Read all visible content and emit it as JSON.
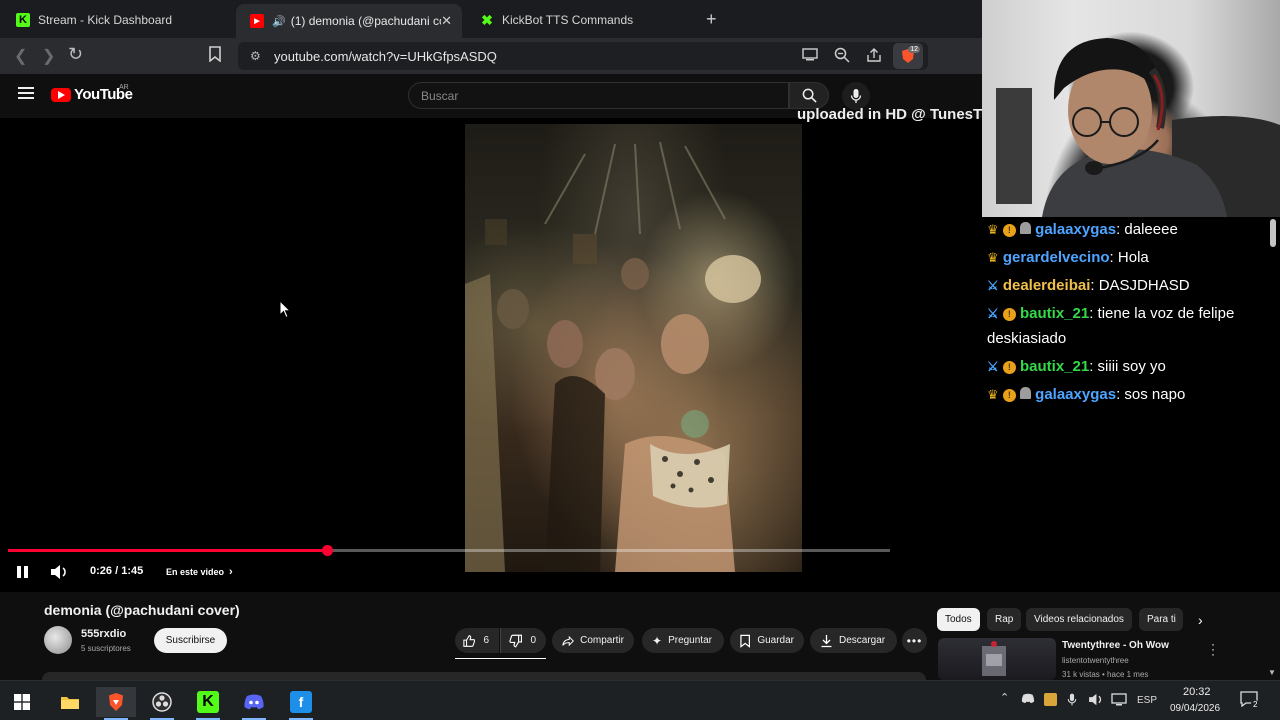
{
  "browser": {
    "tabs": [
      {
        "title": "Stream - Kick Dashboard",
        "icon": "kick-icon"
      },
      {
        "title": "(1) demonia (@pachudani cov",
        "icon": "youtube-icon",
        "active": true,
        "audio": true
      },
      {
        "title": "KickBot TTS Commands",
        "icon": "kickbot-icon"
      }
    ],
    "url": "youtube.com/watch?v=UHkGfpsASDQ",
    "brave_badge": "12"
  },
  "youtube": {
    "logo_text": "YouTube",
    "country_code": "AR",
    "search_placeholder": "Buscar"
  },
  "player": {
    "overlay_text": "uploaded in HD @ TunesT",
    "current_time": "0:26",
    "duration": "1:45",
    "time_separator": " / ",
    "chapter_label": "En este video",
    "progress_fraction": 0.3619,
    "hd_badge": "HD"
  },
  "chat": {
    "messages": [
      {
        "badges": [
          "crown",
          "coin",
          "ghost"
        ],
        "user": "galaaxygas",
        "user_color": "#4ea4ff",
        "text": "daleeee"
      },
      {
        "badges": [
          "crown"
        ],
        "user": "gerardelvecino",
        "user_color": "#4ea4ff",
        "text": "Hola"
      },
      {
        "badges": [
          "sword"
        ],
        "user": "dealerdeibai",
        "user_color": "#f0c04a",
        "text": "DASJDHASD"
      },
      {
        "badges": [
          "sword",
          "coin"
        ],
        "user": "bautix_21",
        "user_color": "#34d94a",
        "text": "tiene la voz de felipe deskiasiado"
      },
      {
        "badges": [
          "sword",
          "coin"
        ],
        "user": "bautix_21",
        "user_color": "#34d94a",
        "text": "siiii soy yo"
      },
      {
        "badges": [
          "crown",
          "coin",
          "ghost"
        ],
        "user": "galaaxygas",
        "user_color": "#4ea4ff",
        "text": "sos napo"
      }
    ]
  },
  "video": {
    "title": "demonia (@pachudani cover)",
    "channel": "555rxdio",
    "subscribers": "5 suscriptores",
    "subscribe_label": "Suscribirse",
    "likes": "6",
    "dislikes": "0",
    "share_label": "Compartir",
    "ask_label": "Preguntar",
    "save_label": "Guardar",
    "download_label": "Descargar"
  },
  "recommendations": {
    "chips": [
      "Todos",
      "Rap",
      "Videos relacionados",
      "Para ti"
    ],
    "first": {
      "title": "Twentythree - Oh Wow",
      "channel": "listentotwentythree",
      "stats": "31 k vistas • hace 1 mes"
    }
  },
  "taskbar": {
    "language": "ESP",
    "time": "20:32",
    "date": "09/04/2026",
    "notification_count": "2"
  },
  "colors": {
    "accent_red": "#ff0033",
    "kick_green": "#53fc18"
  }
}
